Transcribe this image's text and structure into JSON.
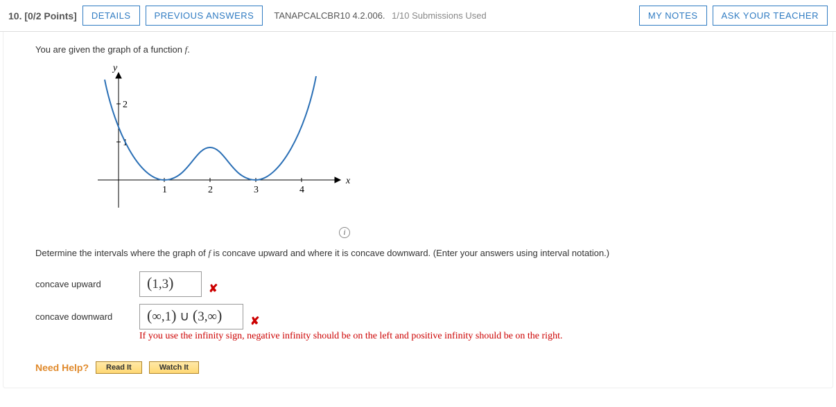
{
  "header": {
    "question_number": "10.",
    "points": "[0/2 Points]",
    "details_btn": "DETAILS",
    "prev_btn": "PREVIOUS ANSWERS",
    "source": "TANAPCALCBR10 4.2.006.",
    "submissions": "1/10 Submissions Used",
    "notes_btn": "MY NOTES",
    "ask_btn": "ASK YOUR TEACHER"
  },
  "intro_prefix": "You are given the graph of a function ",
  "intro_var": "f",
  "intro_suffix": ".",
  "chart_data": {
    "type": "line",
    "xlabel": "x",
    "ylabel": "y",
    "xlim": [
      -0.5,
      4.6
    ],
    "ylim": [
      -0.6,
      2.6
    ],
    "xticks": [
      1,
      2,
      3,
      4
    ],
    "yticks": [
      1,
      2
    ],
    "series": [
      {
        "name": "f",
        "curve": "W-shaped quartic-like: decreases from above y=2 at x≈-0.3, touches y=0 at x=1, rises to local max ≈0.85 at x=2, falls back to y=0 at x=3, then increases steeply past y=2 by x≈4.4"
      }
    ]
  },
  "instruction_prefix": "Determine the intervals where the graph of ",
  "instruction_var": "f",
  "instruction_suffix": " is concave upward and where it is concave downward. (Enter your answers using interval notation.)",
  "answers": {
    "upward_label": "concave upward",
    "upward_value": "(1,3)",
    "downward_label": "concave downward",
    "downward_value": "(∞,1) ∪ (3,∞)"
  },
  "wrong_mark": "✘",
  "hint": "If you use the infinity sign, negative infinity should be on the left and positive infinity should be on the right.",
  "info_icon": "i",
  "need_help": {
    "label": "Need Help?",
    "read": "Read It",
    "watch": "Watch It"
  }
}
